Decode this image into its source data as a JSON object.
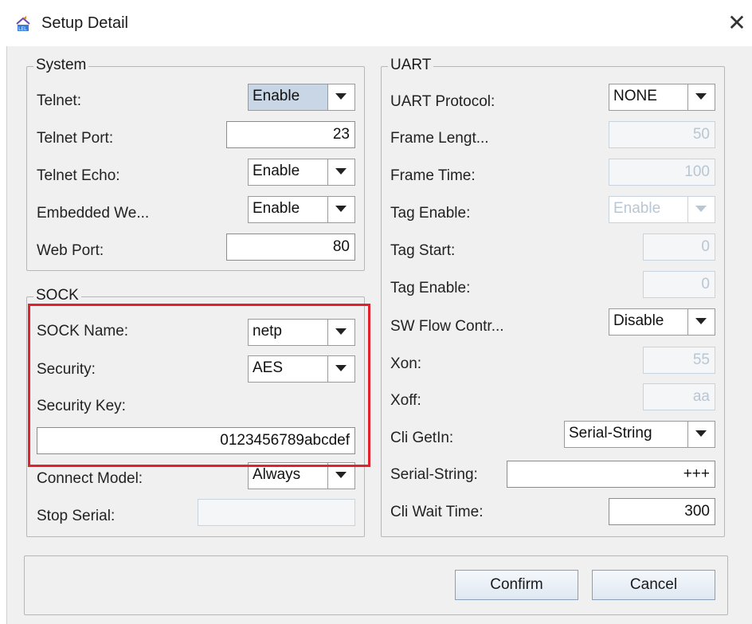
{
  "window": {
    "title": "Setup Detail",
    "close_glyph": "✕",
    "icon": "app-icon"
  },
  "system": {
    "legend": "System",
    "telnet": {
      "label": "Telnet:",
      "value": "Enable"
    },
    "telnet_port": {
      "label": "Telnet Port:",
      "value": "23"
    },
    "telnet_echo": {
      "label": "Telnet Echo:",
      "value": "Enable"
    },
    "embedded_web": {
      "label": "Embedded We...",
      "value": "Enable"
    },
    "web_port": {
      "label": "Web Port:",
      "value": "80"
    }
  },
  "sock": {
    "legend": "SOCK",
    "sock_name": {
      "label": "SOCK Name:",
      "value": "netp"
    },
    "security": {
      "label": "Security:",
      "value": "AES"
    },
    "security_key": {
      "label": "Security Key:",
      "value": "0123456789abcdef"
    },
    "connect_model": {
      "label": "Connect Model:",
      "value": "Always"
    },
    "stop_serial": {
      "label": "Stop Serial:",
      "value": ""
    }
  },
  "uart": {
    "legend": "UART",
    "protocol": {
      "label": "UART Protocol:",
      "value": "NONE"
    },
    "frame_length": {
      "label": "Frame Lengt...",
      "value": "50"
    },
    "frame_time": {
      "label": "Frame Time:",
      "value": "100"
    },
    "tag_enable_1": {
      "label": "Tag Enable:",
      "value": "Enable"
    },
    "tag_start": {
      "label": "Tag Start:",
      "value": "0"
    },
    "tag_enable_2": {
      "label": "Tag Enable:",
      "value": "0"
    },
    "sw_flow": {
      "label": "SW Flow Contr...",
      "value": "Disable"
    },
    "xon": {
      "label": "Xon:",
      "value": "55"
    },
    "xoff": {
      "label": "Xoff:",
      "value": "aa"
    },
    "cli_getin": {
      "label": "Cli GetIn:",
      "value": "Serial-String"
    },
    "serial_string": {
      "label": "Serial-String:",
      "value": "+++"
    },
    "cli_wait_time": {
      "label": "Cli Wait Time:",
      "value": "300"
    }
  },
  "buttons": {
    "confirm": "Confirm",
    "cancel": "Cancel"
  },
  "colors": {
    "highlight_outline": "#e0222f",
    "dialog_background": "#f0f0f0"
  }
}
